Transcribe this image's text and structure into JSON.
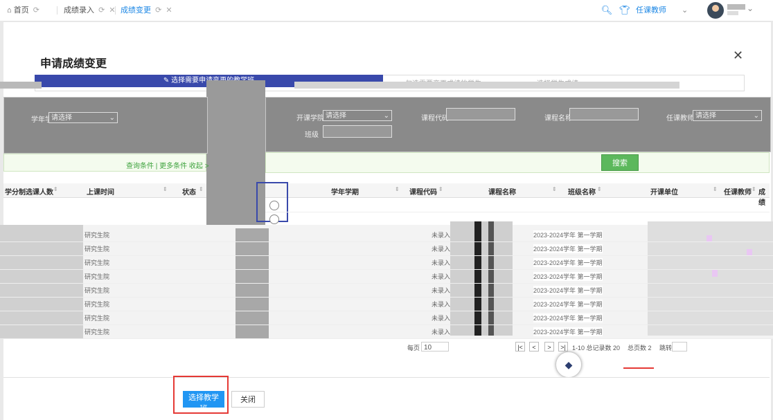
{
  "topbar": {
    "tabs": [
      {
        "label": "首页",
        "icon": "refresh-icon"
      },
      {
        "label": "成绩录入",
        "icon": "refresh-icon"
      },
      {
        "label": "成绩变更",
        "icon": "refresh-icon"
      }
    ],
    "role": "任课教师"
  },
  "dialog": {
    "title": "申请成绩变更",
    "steps": [
      "选择需要申请变更的教学班",
      "勾选需要变更成绩的学生",
      "选择学生成绩"
    ],
    "left_filter": {
      "label": "学年学期",
      "select_value": "请选择",
      "links": "查询条件 | 更多条件   收起 >"
    },
    "right_filter": {
      "label1": "开课学院",
      "select1_value": "请选择",
      "label2": "课程代码",
      "label3": "课程名称",
      "label4": "任课教师",
      "select4_value": "请选择",
      "label5": "班级"
    },
    "search_button": "搜索",
    "left_headers": [
      "学分制",
      "选课人数",
      "上课时间",
      "状态"
    ],
    "right_headers": [
      "学年学期",
      "课程代码",
      "课程名称",
      "班级名称",
      "开课单位",
      "任课教师",
      "成绩"
    ],
    "rows": [
      {
        "status": "未录入",
        "term": "2023-2024学年 第一学期",
        "type": "研究生院"
      },
      {
        "status": "未录入",
        "term": "2023-2024学年 第一学期",
        "type": "研究生院"
      },
      {
        "status": "未录入",
        "term": "2023-2024学年 第一学期",
        "type": "研究生院"
      },
      {
        "status": "未录入",
        "term": "2023-2024学年 第一学期",
        "type": "研究生院"
      },
      {
        "status": "未录入",
        "term": "2023-2024学年 第一学期",
        "type": "研究生院"
      },
      {
        "status": "未录入",
        "term": "2023-2024学年 第一学期",
        "type": "研究生院"
      },
      {
        "status": "未录入",
        "term": "2023-2024学年 第一学期",
        "type": "研究生院"
      },
      {
        "status": "未录入",
        "term": "2023-2024学年 第一学期",
        "type": "研究生院"
      }
    ],
    "pager": {
      "per_page_label": "每页",
      "per_page": "10",
      "range": "1-10 总记录数 20",
      "pages": "总页数 2",
      "jump": "跳转:"
    },
    "buttons": {
      "select": "选择教学班",
      "close": "关闭"
    }
  }
}
